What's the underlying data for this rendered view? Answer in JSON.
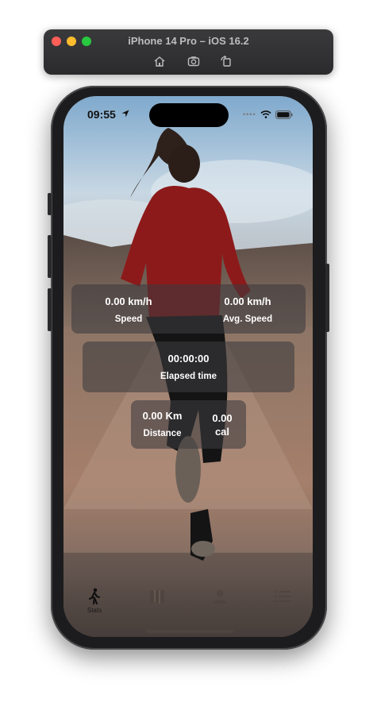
{
  "window": {
    "title": "iPhone 14 Pro – iOS 16.2",
    "icons": [
      "home-icon",
      "screenshot-icon",
      "rotate-icon"
    ]
  },
  "status_bar": {
    "time": "09:55",
    "icons": [
      "location-arrow-icon",
      "wifi-icon",
      "battery-icon"
    ]
  },
  "stats": {
    "speed_value": "0.00 km/h",
    "speed_label": "Speed",
    "avg_speed_value": "0.00 km/h",
    "avg_speed_label": "Avg. Speed",
    "elapsed_value": "00:00:00",
    "elapsed_label": "Elapsed time",
    "distance_value": "0.00 Km",
    "distance_label": "Distance",
    "calories_value_line1": "0.00",
    "calories_value_line2": "cal"
  },
  "tab_bar": {
    "tabs": [
      {
        "label": "Stats",
        "icon": "walking-figure-icon"
      },
      {
        "label": "",
        "icon": "map-icon"
      },
      {
        "label": "",
        "icon": "person-icon"
      },
      {
        "label": "",
        "icon": "list-icon"
      }
    ]
  },
  "background_image": "runner-photo"
}
